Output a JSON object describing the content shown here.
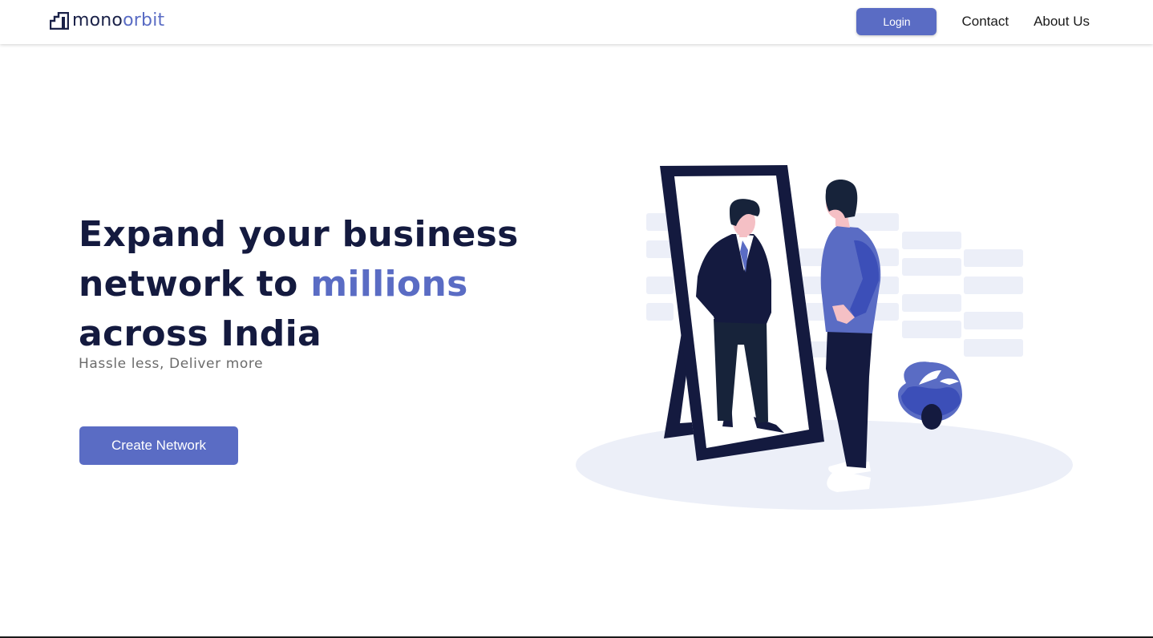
{
  "brand": {
    "name_part1": "mono",
    "name_part2": "rbit",
    "name_o": "o"
  },
  "nav": {
    "login_label": "Login",
    "contact_label": "Contact",
    "about_label": "About Us"
  },
  "hero": {
    "headline_line1": "Expand your business",
    "headline_line2_prefix": "network to ",
    "headline_line2_highlight": "millions",
    "headline_line3": "across India",
    "subhead": "Hassle less, Deliver more",
    "cta_label": "Create Network"
  },
  "colors": {
    "accent": "#5a6cc4",
    "navy": "#141a3f",
    "pale": "#eceff8"
  },
  "icons": {
    "logo": "monorbit-logo-icon",
    "illustration": "man-mirror-illustration"
  }
}
